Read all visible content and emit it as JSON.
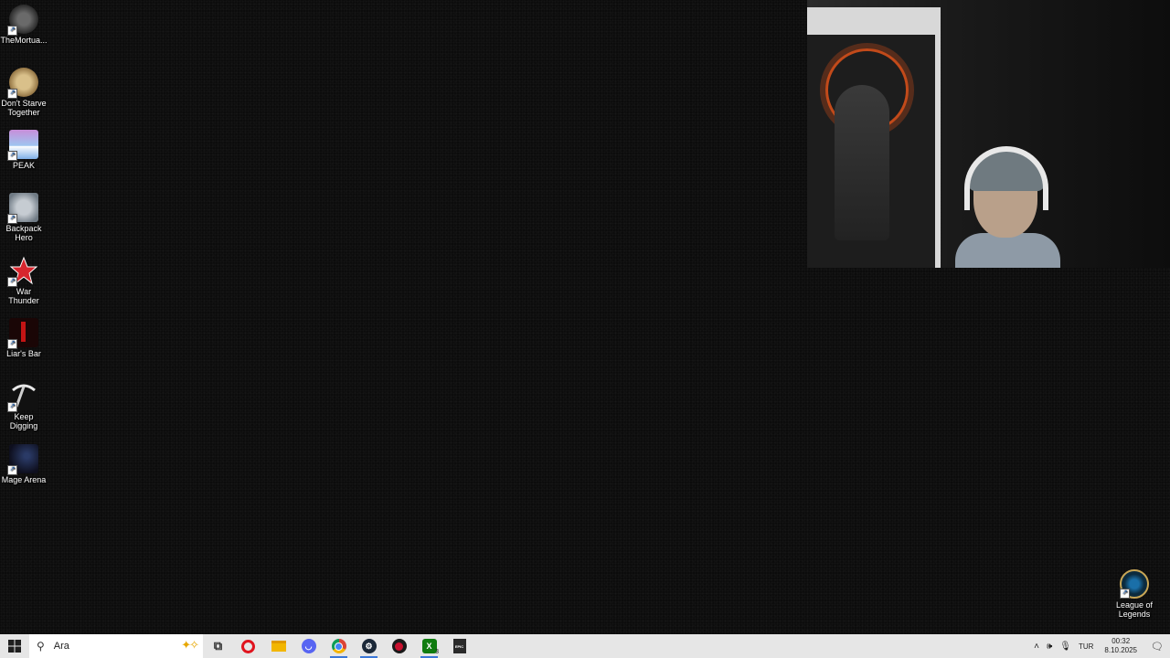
{
  "desktop": {
    "icons": [
      {
        "label": "TheMortua...",
        "icon": "mortuary-assistant-icon"
      },
      {
        "label": "Don't Starve Together",
        "icon": "dont-starve-together-icon"
      },
      {
        "label": "PEAK",
        "icon": "peak-icon"
      },
      {
        "label": "Backpack Hero",
        "icon": "backpack-hero-icon"
      },
      {
        "label": "War Thunder",
        "icon": "war-thunder-icon"
      },
      {
        "label": "Liar's Bar",
        "icon": "liars-bar-icon"
      },
      {
        "label": "Keep Digging",
        "icon": "keep-digging-icon"
      },
      {
        "label": "Mage Arena",
        "icon": "mage-arena-icon"
      }
    ],
    "corner_icon": {
      "label": "League of Legends",
      "icon": "league-of-legends-icon"
    }
  },
  "taskbar": {
    "search_placeholder": "Ara",
    "pinned": [
      {
        "name": "task-view",
        "glyph": "⧉",
        "color": "#333333"
      },
      {
        "name": "opera",
        "glyph": "O",
        "color": "#e0141e"
      },
      {
        "name": "file-explorer",
        "glyph": "▬",
        "color": "#f2b600"
      },
      {
        "name": "discord",
        "glyph": "◉",
        "color": "#5865f2"
      },
      {
        "name": "chrome",
        "glyph": "◎",
        "color": "#2f9e44"
      },
      {
        "name": "steam",
        "glyph": "⚙",
        "color": "#1b2838"
      },
      {
        "name": "red-app",
        "glyph": "●",
        "color": "#c8102e"
      },
      {
        "name": "xbox",
        "glyph": "X",
        "color": "#107c10"
      },
      {
        "name": "epic-games",
        "glyph": "EPIC",
        "color": "#2a2a2a"
      }
    ],
    "xbox_badge": "3",
    "tray": {
      "language": "TUR",
      "time": "00:32",
      "date": "8.10.2025"
    }
  }
}
